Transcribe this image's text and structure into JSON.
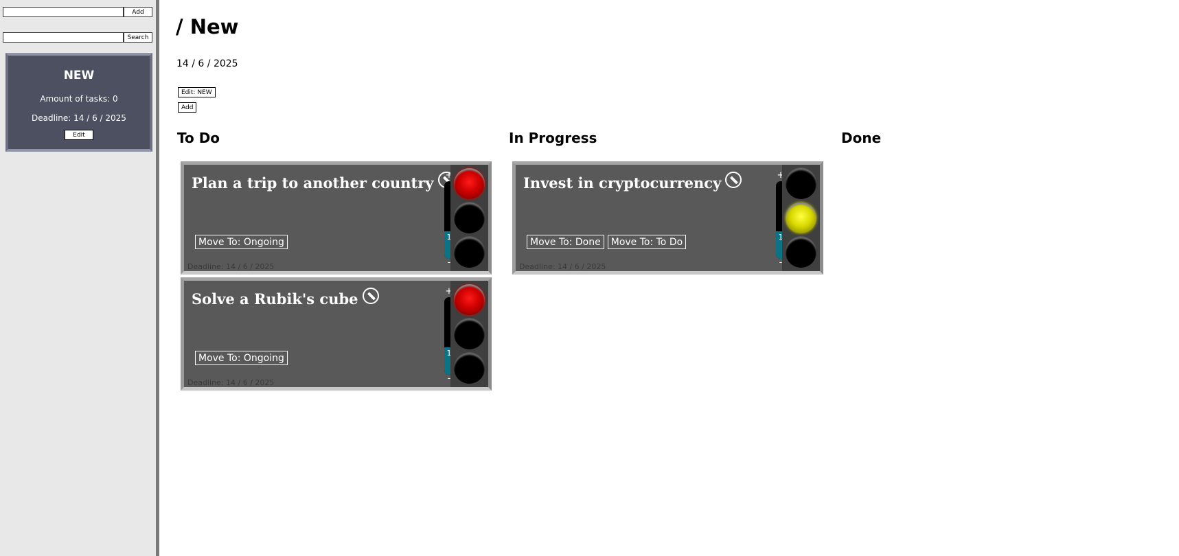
{
  "sidebar": {
    "add_button": "Add",
    "search_button": "Search",
    "add_input_value": "",
    "search_input_value": "",
    "board": {
      "name": "NEW",
      "amount_label": "Amount of tasks: 0",
      "deadline_label": "Deadline: 14 / 6 / 2025",
      "edit_button": "Edit"
    }
  },
  "main": {
    "title": "/ New",
    "date": "14 / 6 / 2025",
    "edit_button": "Edit: NEW",
    "add_button": "Add",
    "columns": [
      {
        "heading": "To Do",
        "tasks": [
          {
            "title": "Plan a trip to another country",
            "buttons": [
              "Move To: Ongoing"
            ],
            "deadline": "Deadline: 14 / 6 / 2025",
            "priority_plus": "+",
            "priority_minus": "-",
            "priority": "1",
            "priority_level": 0.35,
            "light": "red"
          },
          {
            "title": "Solve a Rubik's cube",
            "buttons": [
              "Move To: Ongoing"
            ],
            "deadline": "Deadline: 14 / 6 / 2025",
            "priority_plus": "+",
            "priority_minus": "-",
            "priority": "1",
            "priority_level": 0.35,
            "light": "red"
          }
        ]
      },
      {
        "heading": "In Progress",
        "tasks": [
          {
            "title": "Invest in cryptocurrency",
            "buttons": [
              "Move To: Done",
              "Move To: To Do"
            ],
            "deadline": "Deadline: 14 / 6 / 2025",
            "priority_plus": "+",
            "priority_minus": "-",
            "priority": "1",
            "priority_level": 0.35,
            "light": "yellow"
          }
        ]
      },
      {
        "heading": "Done",
        "tasks": []
      }
    ]
  },
  "colors": {
    "sidebar_bg": "#e8e8e8",
    "board_card_bg": "#4d5060",
    "task_bg": "#595959",
    "priority_fill": "#0e7285",
    "light_red": "#cc0000",
    "light_yellow": "#d8d800"
  },
  "icons": {
    "task_edit": "pencil-icon"
  }
}
